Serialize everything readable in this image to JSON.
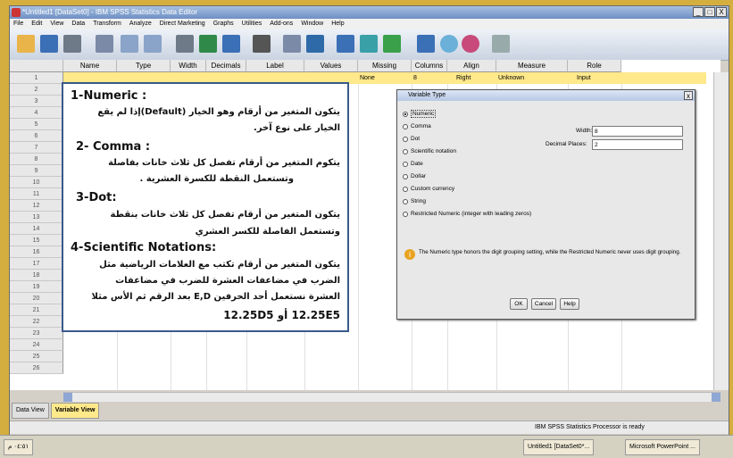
{
  "window": {
    "title": "*Untitled1 [DataSet0] - IBM SPSS Statistics Data Editor",
    "btn_min": "_",
    "btn_max": "□",
    "btn_close": "X"
  },
  "menu": [
    "File",
    "Edit",
    "View",
    "Data",
    "Transform",
    "Analyze",
    "Direct Marketing",
    "Graphs",
    "Utilities",
    "Add-ons",
    "Window",
    "Help"
  ],
  "columns": [
    "Name",
    "Type",
    "Width",
    "Decimals",
    "Label",
    "Values",
    "Missing",
    "Columns",
    "Align",
    "Measure",
    "Role"
  ],
  "row1": {
    "missing": "None",
    "columns": "8",
    "align": "Right",
    "measure": "Unknown",
    "role": "Input"
  },
  "row_numbers": [
    "1",
    "2",
    "3",
    "4",
    "5",
    "6",
    "7",
    "8",
    "9",
    "10",
    "11",
    "12",
    "13",
    "14",
    "15",
    "16",
    "17",
    "18",
    "19",
    "20",
    "21",
    "22",
    "23",
    "24",
    "25",
    "26"
  ],
  "overlay": {
    "h1": "1-Numeric :",
    "l1a": "يتكون المتغير من أرقام وهو الخيار (Default)إذا لم يقع",
    "l1b": "الخيار على نوع آخر.",
    "h2": "2- Comma :",
    "l2a": "يتكوم المتغير من أرقام تفصل كل ثلاث خانات بفاصلة",
    "l2b": "وتستعمل النقطة للكسرة العشرية .",
    "h3": "3-Dot:",
    "l3a": "يتكون المتغير من أرقام تفصل كل ثلاث خانات بنقطة",
    "l3b": "وتستعمل الفاصلة للكسر العشري",
    "h4": "4-Scientific Notations:",
    "l4a": "يتكون المتغير من أرقام تكتب مع العلامات الرياضية مثل",
    "l4b": "الضرب في مضاعفات العشرة للضرب في مضاعفات",
    "l4c": "العشرة نستعمل أحد الحرفين E,D بعد الرقم ثم الأس مثلا",
    "l4d": "12.25E5  أو  12.25D5"
  },
  "dialog": {
    "title": "Variable Type",
    "close": "x",
    "options": [
      "Numeric",
      "Comma",
      "Dot",
      "Scientific notation",
      "Date",
      "Dollar",
      "Custom currency",
      "String",
      "Restricted Numeric (integer with leading zeros)"
    ],
    "width_label": "Width:",
    "width_value": "8",
    "decimal_label": "Decimal Places:",
    "decimal_value": "2",
    "info": "The Numeric type honors the digit grouping setting, while the Restricted Numeric never uses digit grouping.",
    "ok": "OK",
    "cancel": "Cancel",
    "help": "Help"
  },
  "tabs": {
    "data_view": "Data View",
    "variable_view": "Variable View"
  },
  "status": "IBM SPSS Statistics Processor is ready",
  "taskbar": {
    "spss": "Untitled1 [DataSet0*...",
    "ppt": "Microsoft PowerPoint ...",
    "time": "٠٤:٥١ م"
  },
  "colors": {
    "accent": "#3a5a8a",
    "highlight_row": "#ffe98a",
    "desktop": "#d4ae3e"
  }
}
